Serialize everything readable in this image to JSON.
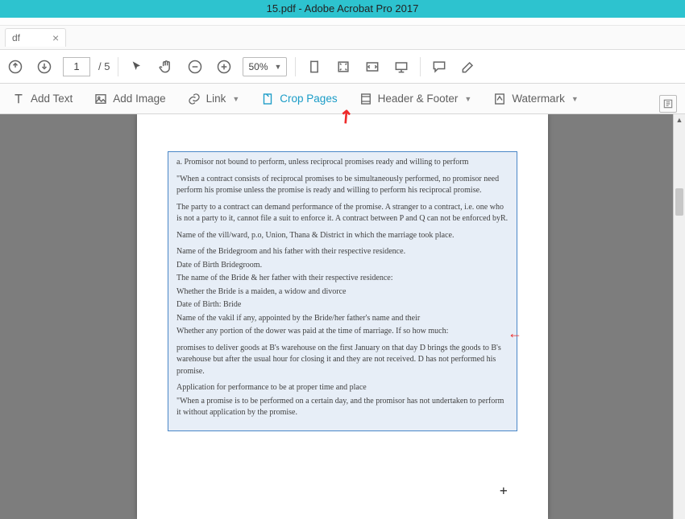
{
  "window": {
    "title": "15.pdf - Adobe Acrobat Pro 2017"
  },
  "tab": {
    "name": "df",
    "close": "×"
  },
  "toolbar": {
    "page_current": "1",
    "page_total": "/ 5",
    "zoom": "50%"
  },
  "editbar": {
    "add_text": "Add Text",
    "add_image": "Add Image",
    "link": "Link",
    "crop_pages": "Crop Pages",
    "header_footer": "Header & Footer",
    "watermark": "Watermark"
  },
  "doc": {
    "p1": "a. Promisor not bound to perform, unless reciprocal promises ready and willing to perform",
    "p2": "\"When a contract consists of reciprocal promises to be simultaneously performed, no promisor need perform his promise unless the promise is ready and willing to perform his reciprocal promise.",
    "p3": "The party to a contract can demand performance of the promise. A stranger to a contract, i.e. one who is not a party to it, cannot file a suit to enforce it. A contract between P and Q can not be enforced byR.",
    "p4": "Name of the vill/ward, p.o, Union, Thana & District in which the marriage took place.",
    "p5": "Name of the Bridegroom and his father with their respective residence.",
    "p6": "Date of Birth Bridegroom.",
    "p7": "The name of the Bride & her father with their respective residence:",
    "p8": "Whether the Bride is a maiden, a widow and divorce",
    "p9": "Date of Birth: Bride",
    "p10": "Name of the vakil if any, appointed by the Bride/her father's name and their",
    "p11": "Whether any portion of the dower was paid at the time of marriage. If so how much:",
    "p12": "promises to deliver goods at B's warehouse on the first January on that day D brings the goods to B's warehouse but after the usual hour for closing it and they are not received. D has not performed his promise.",
    "p13": "Application for performance to be at proper time and place",
    "p14": "\"When a promise is to be performed on a certain day, and the promisor has not undertaken to perform it without application by the promise."
  },
  "arrows": {
    "a1": "↗",
    "a2": "←"
  },
  "cursor": "+"
}
